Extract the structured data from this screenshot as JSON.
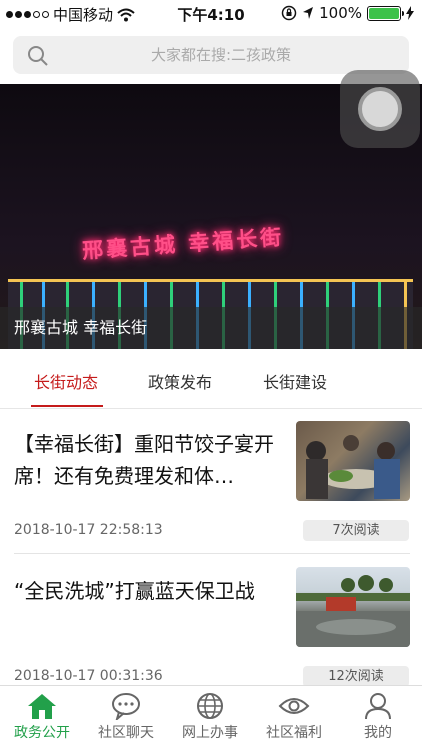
{
  "status": {
    "carrier": "中国移动",
    "time": "下午4:10",
    "battery": "100%"
  },
  "search": {
    "placeholder": "大家都在搜:二孩政策"
  },
  "banner": {
    "caption": "邢襄古城 幸福长街",
    "sign_text": "邢襄古城 幸福长街"
  },
  "tabs": [
    {
      "label": "长街动态",
      "active": true
    },
    {
      "label": "政策发布",
      "active": false
    },
    {
      "label": "长街建设",
      "active": false
    }
  ],
  "news": [
    {
      "title": "【幸福长街】重阳节饺子宴开席！还有免费理发和体…",
      "date": "2018-10-17 22:58:13",
      "reads": "7次阅读"
    },
    {
      "title": "“全民洗城”打赢蓝天保卫战",
      "date": "2018-10-17 00:31:36",
      "reads": "12次阅读"
    }
  ],
  "tabbar": [
    {
      "label": "政务公开",
      "icon": "home-icon",
      "active": true
    },
    {
      "label": "社区聊天",
      "icon": "chat-icon",
      "active": false
    },
    {
      "label": "网上办事",
      "icon": "globe-icon",
      "active": false
    },
    {
      "label": "社区福利",
      "icon": "eye-icon",
      "active": false
    },
    {
      "label": "我的",
      "icon": "user-icon",
      "active": false
    }
  ],
  "colors": {
    "accent_red": "#c51b1b",
    "accent_green": "#22a04a"
  }
}
